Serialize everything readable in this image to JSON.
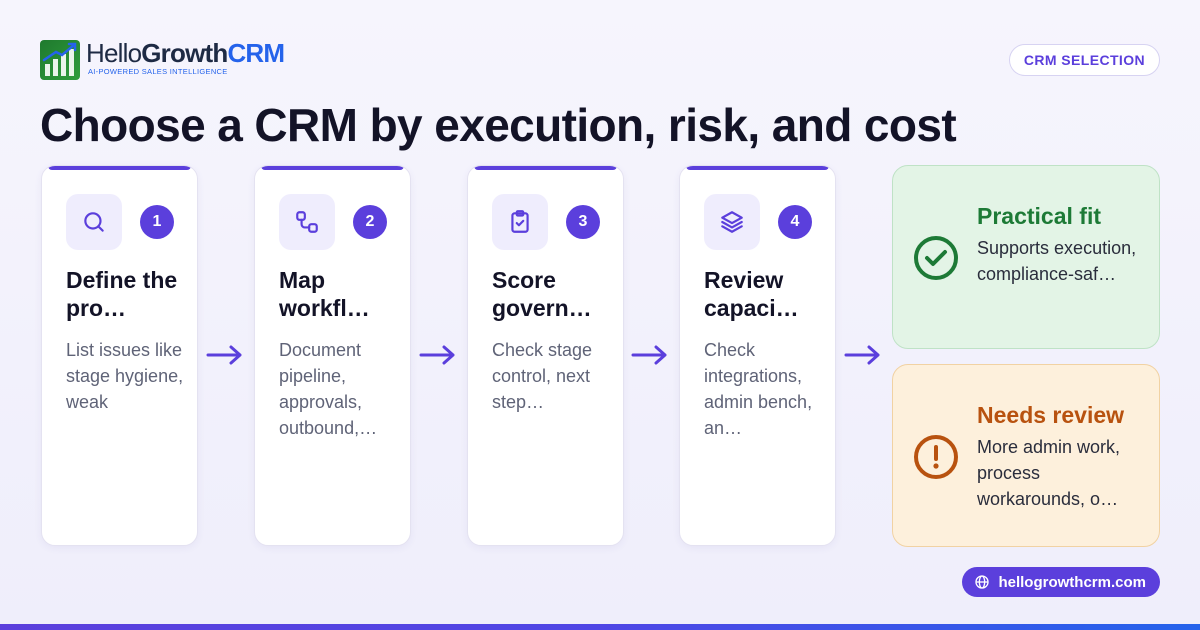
{
  "brand": {
    "name_light": "Hello",
    "name_bold": "Growth",
    "name_accent": "CRM",
    "tagline": "AI-POWERED SALES INTELLIGENCE"
  },
  "category_tag": "CRM SELECTION",
  "title": "Choose a CRM by execution, risk, and cost",
  "steps": [
    {
      "number": "1",
      "icon": "search-icon",
      "title": "Define the pro…",
      "description": "List issues like stage hygiene, weak"
    },
    {
      "number": "2",
      "icon": "workflow-icon",
      "title": "Map workfl…",
      "description": "Document pipeline, approvals, outbound,…"
    },
    {
      "number": "3",
      "icon": "clipboard-check-icon",
      "title": "Score govern…",
      "description": "Check stage control, next step…"
    },
    {
      "number": "4",
      "icon": "layers-icon",
      "title": "Review capaci…",
      "description": "Check integrations, admin bench, an…"
    }
  ],
  "outcomes": {
    "good": {
      "icon": "check-circle-icon",
      "title": "Practical fit",
      "description": "Supports execution, compliance-saf…",
      "color": "#1d7a36"
    },
    "warn": {
      "icon": "alert-circle-icon",
      "title": "Needs review",
      "description": "More admin work, process workarounds, o…",
      "color": "#b8520f"
    }
  },
  "website": {
    "icon": "globe-icon",
    "label": "hellogrowthcrm.com"
  },
  "colors": {
    "accent": "#5b3fdc",
    "good": "#1d7a36",
    "warn": "#b8520f",
    "brand_blue": "#2563eb"
  }
}
